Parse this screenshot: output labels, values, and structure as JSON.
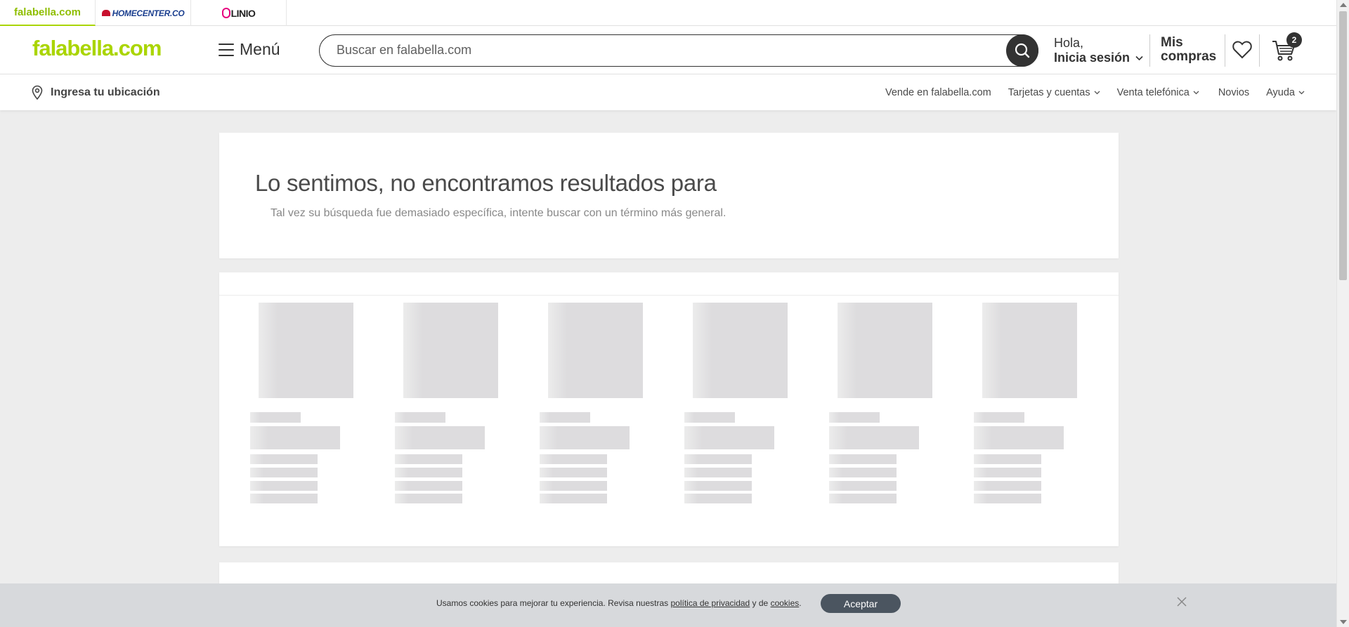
{
  "brand_tabs": [
    {
      "label": "falabella.com"
    },
    {
      "label": "HOMECENTER.CO"
    },
    {
      "label": "LINIO"
    }
  ],
  "header": {
    "logo": "falabella.com",
    "menu_label": "Menú",
    "search_placeholder": "Buscar en falabella.com",
    "greeting_hello": "Hola,",
    "greeting_login": "Inicia sesión",
    "purchases_line1": "Mis",
    "purchases_line2": "compras",
    "cart_count": "2"
  },
  "subnav": {
    "location_label": "Ingresa tu ubicación",
    "links": [
      "Vende en falabella.com",
      "Tarjetas y cuentas",
      "Venta telefónica",
      "Novios",
      "Ayuda"
    ]
  },
  "no_results": {
    "title": "Lo sentimos, no encontramos resultados para",
    "subtitle": "Tal vez su búsqueda fue demasiado específica, intente buscar con un término más general."
  },
  "cookies": {
    "text_before": "Usamos cookies para mejorar tu experiencia. Revisa nuestras ",
    "privacy_link": "política de privacidad",
    "text_mid": " y de ",
    "cookies_link": "cookies",
    "text_end": ".",
    "accept_label": "Aceptar"
  },
  "colors": {
    "brand_green": "#aad500",
    "dark": "#333333",
    "accept_button": "#4b5560",
    "cookie_bar": "#d7d9dc"
  }
}
